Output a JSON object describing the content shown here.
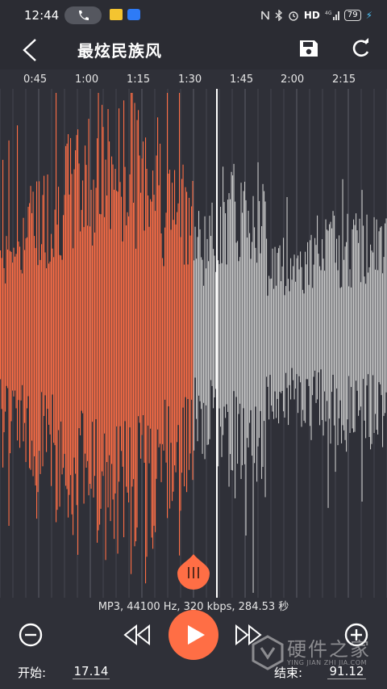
{
  "status_bar": {
    "time": "12:44",
    "network": "HD",
    "signal_label": "4G",
    "battery": "79",
    "icons": [
      "phone-icon",
      "email-app-icon",
      "cloud-app-icon",
      "nfc-icon",
      "bluetooth-icon",
      "alarm-icon",
      "signal-icon",
      "battery-icon",
      "charging-icon"
    ]
  },
  "header": {
    "title": "最炫民族风",
    "icons": [
      "back-icon",
      "save-icon",
      "refresh-icon"
    ]
  },
  "timeline": {
    "ticks": [
      "0:45",
      "1:00",
      "1:15",
      "1:30",
      "1:45",
      "2:00",
      "2:15"
    ]
  },
  "waveform": {
    "selected_color": "#ff6e45",
    "unselected_color": "#c8c8c8",
    "selection_start_seconds": 17.14,
    "selection_end_seconds": 91.12
  },
  "info": {
    "file_info": "MP3, 44100 Hz, 320 kbps, 284.53 秒"
  },
  "controls": {
    "icons": [
      "zoom-out-icon",
      "rewind-icon",
      "play-icon",
      "fast-forward-icon",
      "zoom-in-icon"
    ],
    "accent": "#ff6e45"
  },
  "range": {
    "start_label": "开始:",
    "start_value": "17.14",
    "end_label": "结束:",
    "end_value": "91.12"
  },
  "watermark": {
    "text": "硬件之家",
    "subtext": "YING JIAN ZHI JIA.COM"
  }
}
